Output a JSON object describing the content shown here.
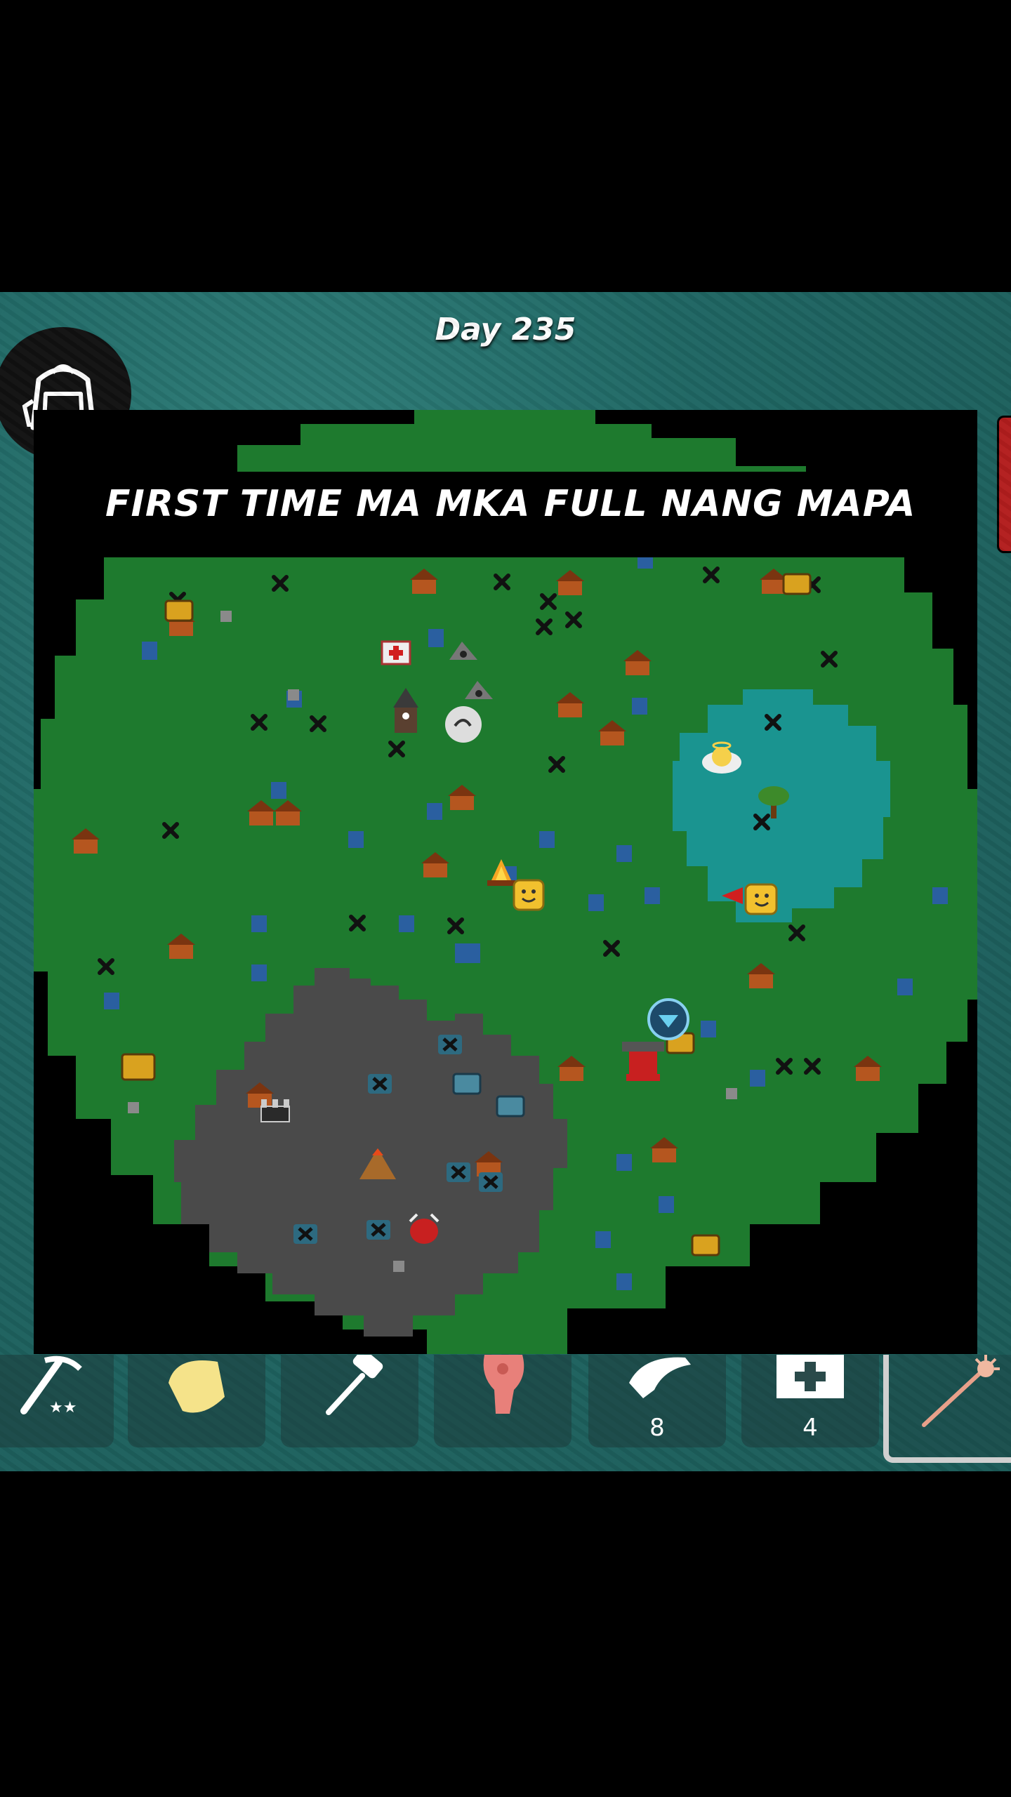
{
  "hud": {
    "day_label": "Day 235",
    "caption": "FIRST TIME MA MKA FULL NANG MAPA"
  },
  "backpack": {
    "icon": "backpack-icon"
  },
  "map": {
    "colors": {
      "grass": "#1e7a2e",
      "lake": "#1a9490",
      "rock": "#4a4a4a",
      "water_tile": "#2a5fa0",
      "house": "#b5561f",
      "border": "#000000"
    },
    "markers": [
      "house-icon",
      "chest-icon",
      "campfire-icon",
      "player-marker-icon",
      "anvil-icon",
      "volcano-icon",
      "angel-icon",
      "tree-icon",
      "wizard-tower-icon",
      "skull-icon",
      "cave-icon",
      "portal-icon",
      "boss-icon"
    ]
  },
  "hotbar": {
    "slots": [
      {
        "icon": "pickaxe-icon",
        "count": ""
      },
      {
        "icon": "helmet-icon",
        "count": ""
      },
      {
        "icon": "hammer-icon",
        "count": ""
      },
      {
        "icon": "meat-icon",
        "count": ""
      },
      {
        "icon": "bandage-icon",
        "count": "8"
      },
      {
        "icon": "medkit-icon",
        "count": "4"
      },
      {
        "icon": "spiked-staff-icon",
        "count": "",
        "selected": true
      }
    ]
  }
}
